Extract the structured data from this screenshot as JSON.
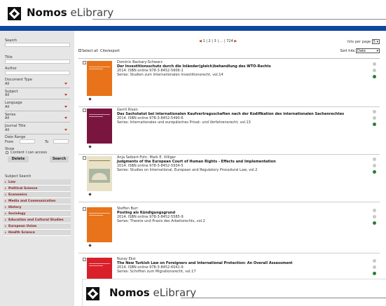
{
  "brand": {
    "name": "Nomos",
    "suffix": " eLibrary"
  },
  "search": {
    "search_label": "Search",
    "title_label": "Title",
    "author_label": "Author",
    "doctype_label": "Document Type",
    "doctype_value": "All",
    "subject_label": "Subject",
    "subject_value": "All",
    "language_label": "Language",
    "language_value": "All",
    "series_label": "Series",
    "series_value": "All",
    "journal_label": "Journal Title",
    "journal_value": "All",
    "daterange_label": "Date Range",
    "from_label": "From",
    "to_label": "To",
    "show_label": "Show",
    "content_access_label": "Content I can access",
    "delete_label": "Delete",
    "search_button_label": "Search"
  },
  "subjects": {
    "title": "Subject Search",
    "items": [
      "Law",
      "Political Science",
      "Economics",
      "Media and Communication",
      "History",
      "Sociology",
      "Education and Cultural Studies",
      "European Union",
      "Health Science"
    ]
  },
  "pager": {
    "prev": "◀",
    "pages": "1 | 2 | 3 | ... | 724",
    "next": "▶"
  },
  "hits": {
    "label": "hits per page",
    "value": "5"
  },
  "toolbar": {
    "select_all": "Select all",
    "cite_export": "Cite/export",
    "sort_label": "Sort hits",
    "sort_value": "Date"
  },
  "colors": {
    "brand_blue": "#0d47a1",
    "accent_red": "#c0392b",
    "available_green": "#2e7d32"
  },
  "results": [
    {
      "author": "Dominic Backary-Schwarz",
      "title": "Der Investitionsschutz durch die Inländer(gleich)behandlung des WTO-Rechts",
      "meta": "2014. ISBN online 978-3-8452-5606-1",
      "series": "Series: Studien zum Internationalen Investitionsrecht, vol.14",
      "cover_color": "#e8731a"
    },
    {
      "author": "Gerrit Rixen",
      "title": "Das Sachstatut bei internationalen Kaufvertragsschaften nach der Kodifikation des internationalen Sachenrechtes",
      "meta": "2014. ISBN online 978-3-8452-5490-6",
      "series": "Series: Internationales und europäisches Privat- und Verfahrensrecht, vol.13",
      "cover_color": "#7a1540"
    },
    {
      "author": "Anja Seibert-Fohr, Mark E. Villiger",
      "title": "Judgments of the European Court of Human Rights - Effects and Implementation",
      "meta": "2014. ISBN online 978-3-8452-5934-5",
      "series": "Series: Studies on International, European and Regulatory Procedural Law, vol.2",
      "cover_color": "#e9e2c6"
    },
    {
      "author": "Steffen Burr",
      "title": "Posting als Kündigungsgrund",
      "meta": "2014. ISBN online 978-3-8452-5585-9",
      "series": "Series: Theorie und Praxis des Arbeitsrechts, vol.2",
      "cover_color": "#e8731a"
    },
    {
      "author": "Nuray Eksi",
      "title": "The New Turkish Law on Foreigners and International Protection: An Overall Assessment",
      "meta": "2014. ISBN online 978-3-8452-6041-9",
      "series": "Series: Schriften zum Migrationsrecht, vol.17",
      "cover_color": "#d91f2a"
    }
  ]
}
